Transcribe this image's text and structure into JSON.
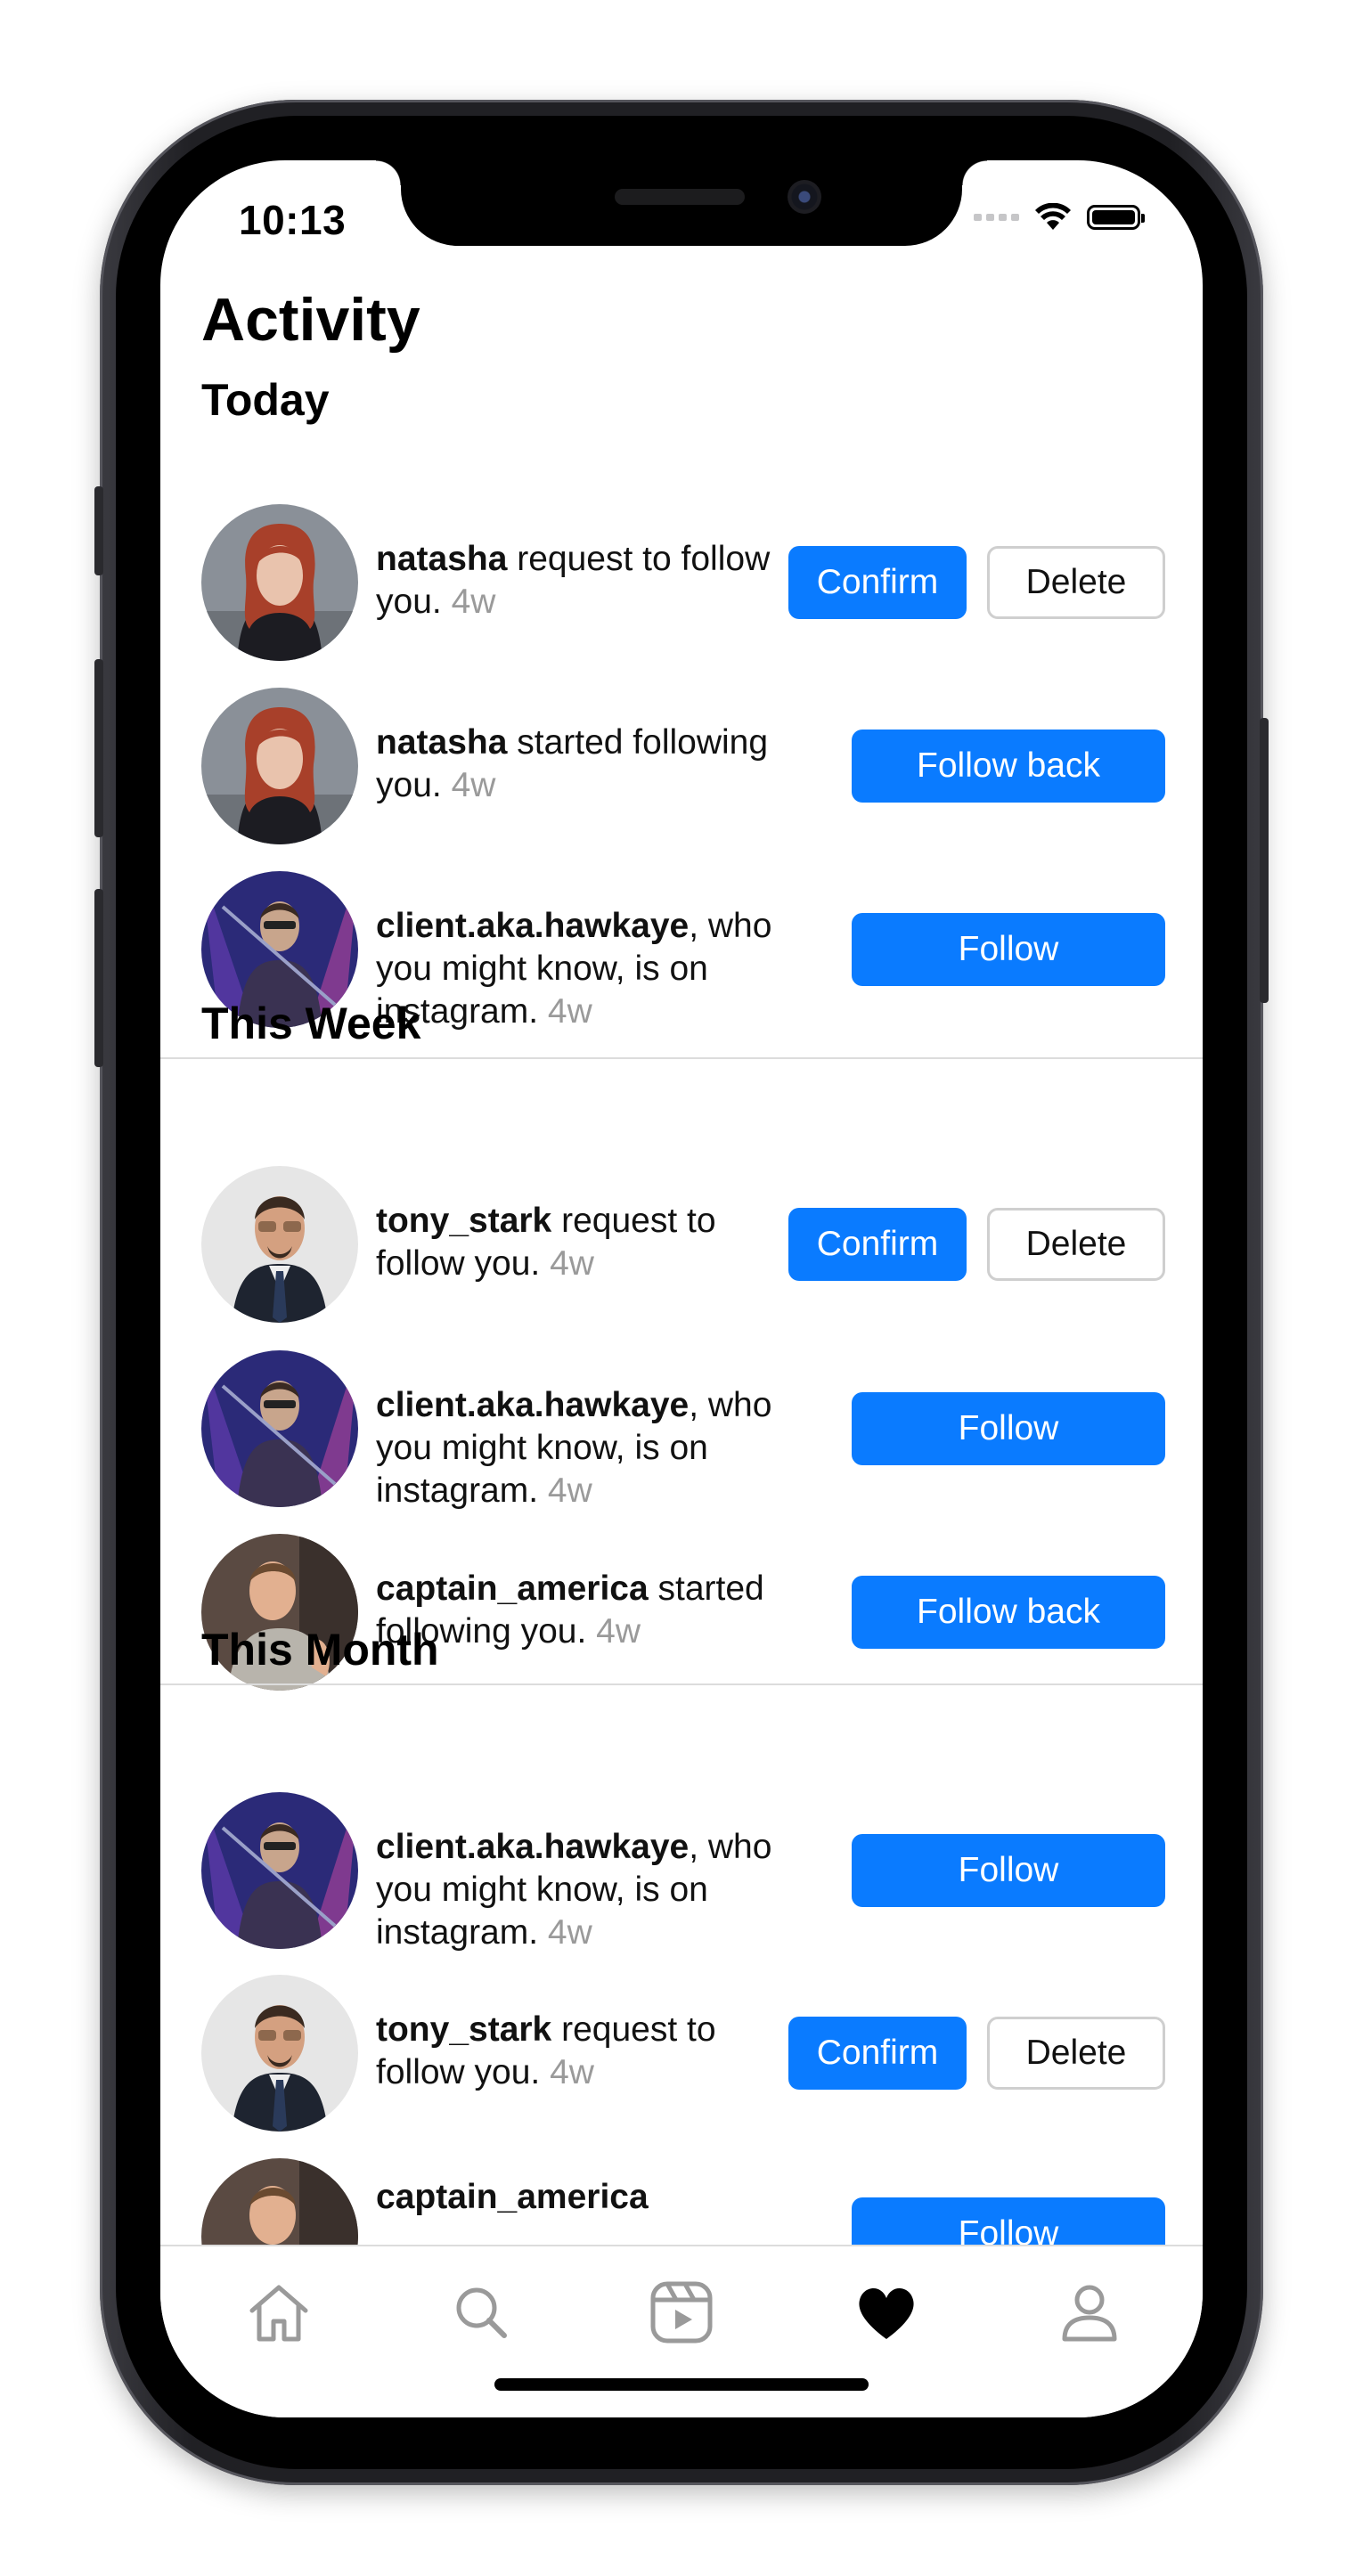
{
  "status_bar": {
    "time": "10:13"
  },
  "page_title": "Activity",
  "colors": {
    "accent": "#0a7bff",
    "muted": "#9a9a9a",
    "border": "#cfcfcf"
  },
  "sections": [
    {
      "title": "Today",
      "items": [
        {
          "user": "natasha",
          "text": " request to follow you.",
          "time": "4w",
          "avatar": "natasha",
          "buttons": [
            "Confirm",
            "Delete"
          ]
        },
        {
          "user": "natasha",
          "text": " started following you.",
          "time": "4w",
          "avatar": "natasha",
          "buttons": [
            "Follow back"
          ]
        },
        {
          "user": "client.aka.hawkaye",
          "text": ", who you might know, is on instagram.",
          "time": "4w",
          "avatar": "hawkeye",
          "buttons": [
            "Follow"
          ]
        }
      ]
    },
    {
      "title": "This Week",
      "items": [
        {
          "user": "tony_stark",
          "text": " request to follow you.",
          "time": "4w",
          "avatar": "tony",
          "buttons": [
            "Confirm",
            "Delete"
          ]
        },
        {
          "user": "client.aka.hawkaye",
          "text": ", who you might know, is on instagram.",
          "time": "4w",
          "avatar": "hawkeye",
          "buttons": [
            "Follow"
          ]
        },
        {
          "user": "captain_america",
          "text": " started following you.",
          "time": "4w",
          "avatar": "captain",
          "buttons": [
            "Follow back"
          ]
        }
      ]
    },
    {
      "title": "This Month",
      "items": [
        {
          "user": "client.aka.hawkaye",
          "text": ", who you might know, is on instagram.",
          "time": "4w",
          "avatar": "hawkeye",
          "buttons": [
            "Follow"
          ]
        },
        {
          "user": "tony_stark",
          "text": " request to follow you.",
          "time": "4w",
          "avatar": "tony",
          "buttons": [
            "Confirm",
            "Delete"
          ]
        },
        {
          "user": "captain_america",
          "text": "",
          "time": "",
          "avatar": "captain",
          "buttons": [
            "Follow"
          ]
        }
      ]
    }
  ],
  "tabbar": {
    "items": [
      {
        "icon": "home-icon"
      },
      {
        "icon": "search-icon"
      },
      {
        "icon": "reels-icon"
      },
      {
        "icon": "heart-icon",
        "active": true
      },
      {
        "icon": "profile-icon"
      }
    ]
  }
}
